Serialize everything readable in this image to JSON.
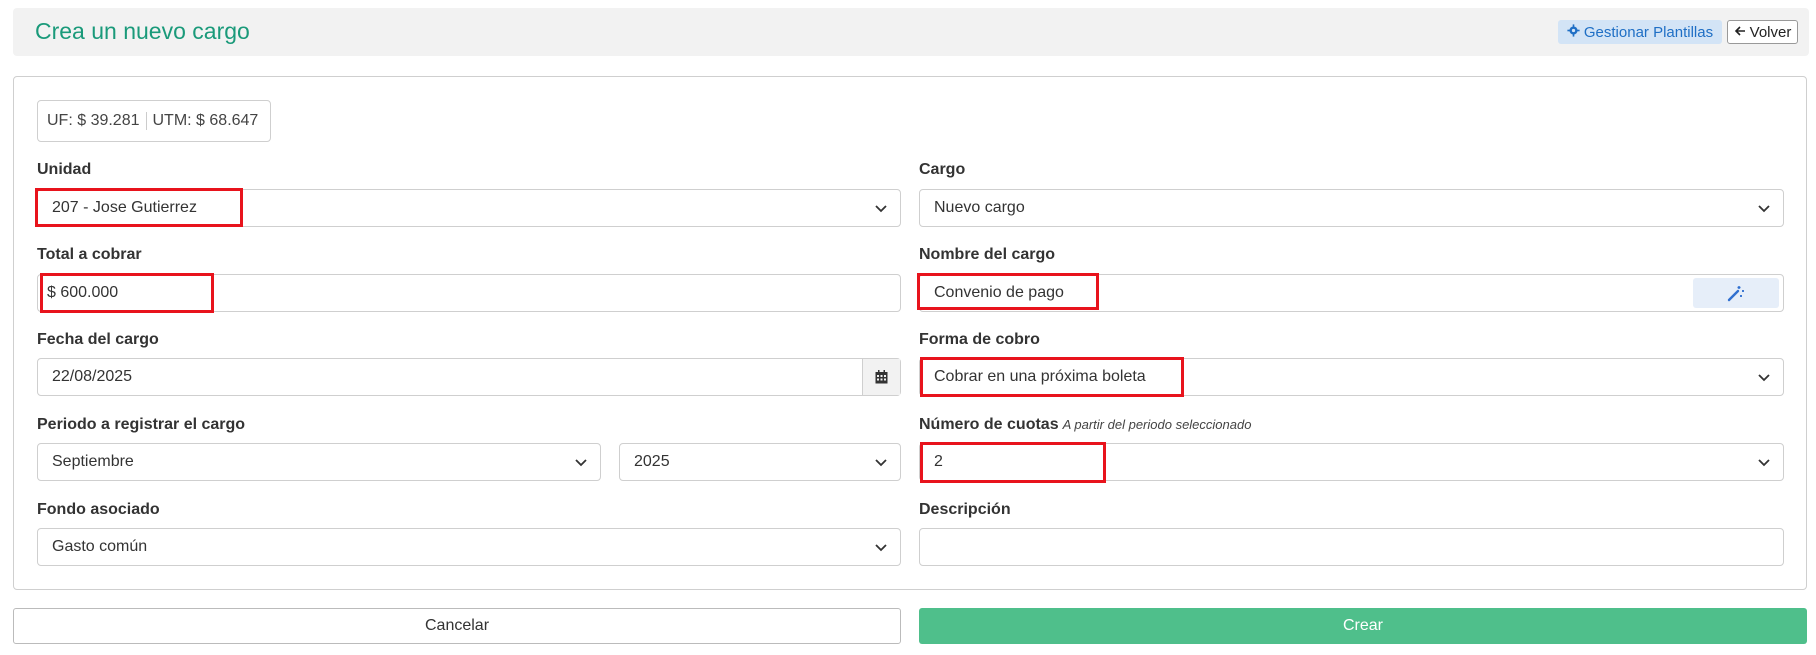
{
  "header": {
    "title": "Crea un nuevo cargo",
    "templates_label": "Gestionar Plantillas",
    "back_label": "Volver"
  },
  "rates": {
    "uf": "UF: $ 39.281",
    "utm": "UTM: $ 68.647"
  },
  "form": {
    "unidad": {
      "label": "Unidad",
      "value": "207 - Jose Gutierrez"
    },
    "cargo": {
      "label": "Cargo",
      "value": "Nuevo cargo"
    },
    "total": {
      "label": "Total a cobrar",
      "value": "$ 600.000"
    },
    "nombre": {
      "label": "Nombre del cargo",
      "value": "Convenio de pago"
    },
    "fecha": {
      "label": "Fecha del cargo",
      "value": "22/08/2025"
    },
    "forma": {
      "label": "Forma de cobro",
      "value": "Cobrar en una próxima boleta"
    },
    "periodo": {
      "label": "Periodo a registrar el cargo",
      "month": "Septiembre",
      "year": "2025"
    },
    "cuotas": {
      "label": "Número de cuotas",
      "hint": "A partir del periodo seleccionado",
      "value": "2"
    },
    "fondo": {
      "label": "Fondo asociado",
      "value": "Gasto común"
    },
    "descripcion": {
      "label": "Descripción",
      "value": ""
    }
  },
  "actions": {
    "cancel_label": "Cancelar",
    "create_label": "Crear"
  },
  "colors": {
    "title": "#1a9a7a",
    "create_button": "#4fbf8b",
    "highlight": "#e8131c",
    "templates_button": "#d3e4f6"
  }
}
